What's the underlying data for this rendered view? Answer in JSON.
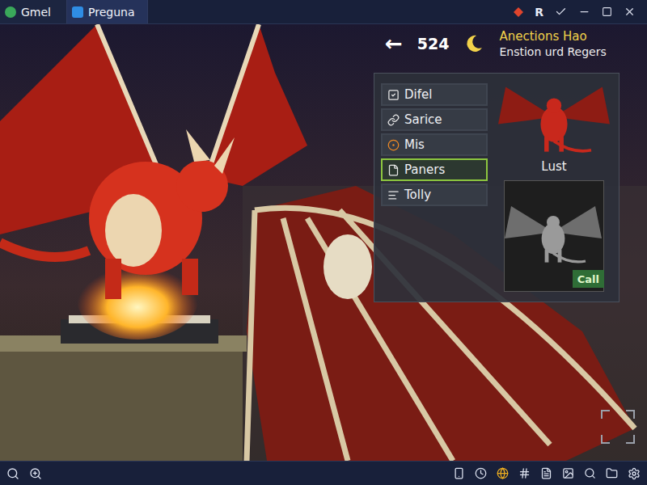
{
  "window": {
    "tabs": [
      {
        "label": "Gmel",
        "selected": false
      },
      {
        "label": "Preguna",
        "selected": true
      }
    ],
    "badge": "R"
  },
  "hud": {
    "back": "←",
    "count": "524",
    "title": "Anections Hao",
    "subtitle": "Enstion urd Regers"
  },
  "menu": {
    "items": [
      {
        "label": "Difel",
        "selected": false
      },
      {
        "label": "Sarice",
        "selected": false
      },
      {
        "label": "Mis",
        "selected": false
      },
      {
        "label": "Paners",
        "selected": true
      },
      {
        "label": "Tolly",
        "selected": false
      }
    ]
  },
  "cards": [
    {
      "label": "Lust",
      "kind": "caption"
    },
    {
      "label": "Call",
      "kind": "button"
    }
  ]
}
